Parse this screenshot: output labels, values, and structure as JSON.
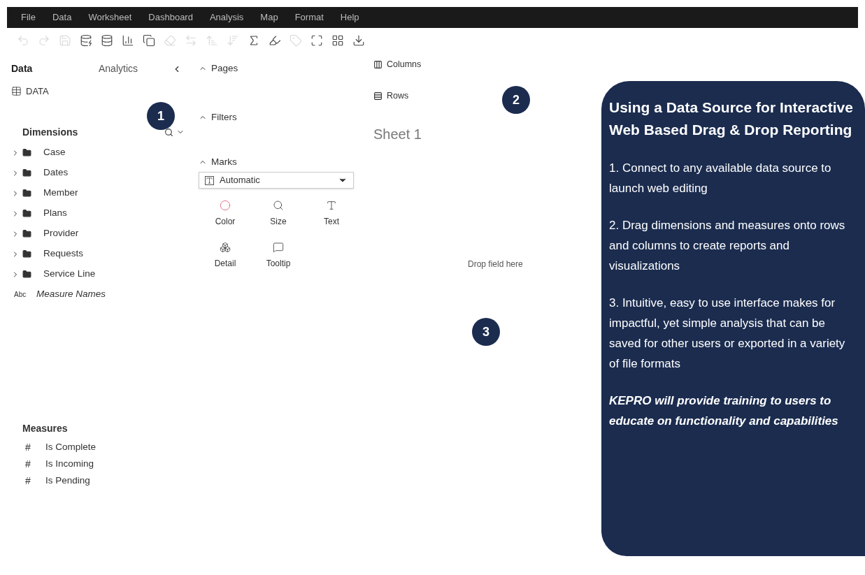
{
  "menu": [
    "File",
    "Data",
    "Worksheet",
    "Dashboard",
    "Analysis",
    "Map",
    "Format",
    "Help"
  ],
  "toolbar": [
    {
      "kind": "undo",
      "disabled": true
    },
    {
      "kind": "redo",
      "disabled": true
    },
    {
      "kind": "save",
      "disabled": true
    },
    {
      "kind": "new-source",
      "disabled": false
    },
    {
      "kind": "pause",
      "disabled": false
    },
    {
      "kind": "new-sheet",
      "disabled": false
    },
    {
      "kind": "duplicate",
      "disabled": false
    },
    {
      "kind": "clear",
      "disabled": true
    },
    {
      "kind": "swap",
      "disabled": true
    },
    {
      "kind": "sort-asc",
      "disabled": true
    },
    {
      "kind": "sort-desc",
      "disabled": true
    },
    {
      "kind": "sum",
      "disabled": false
    },
    {
      "kind": "highlight",
      "disabled": false
    },
    {
      "kind": "label",
      "disabled": true
    },
    {
      "kind": "fit",
      "disabled": false
    },
    {
      "kind": "show-me",
      "disabled": false
    },
    {
      "kind": "download",
      "disabled": false
    }
  ],
  "side_tabs": [
    {
      "label": "Data",
      "selected": true
    },
    {
      "label": "Analytics",
      "selected": false
    }
  ],
  "data_source": "DATA",
  "dimensions": {
    "title": "Dimensions",
    "items": [
      {
        "label": "Case",
        "kind": "folder"
      },
      {
        "label": "Dates",
        "kind": "folder"
      },
      {
        "label": "Member",
        "kind": "folder"
      },
      {
        "label": "Plans",
        "kind": "folder"
      },
      {
        "label": "Provider",
        "kind": "folder"
      },
      {
        "label": "Requests",
        "kind": "folder"
      },
      {
        "label": "Service Line",
        "kind": "folder"
      },
      {
        "label": "Measure Names",
        "kind": "text",
        "type_label": "Abc"
      }
    ]
  },
  "measures": {
    "title": "Measures",
    "items": [
      {
        "label": "Is Complete",
        "type_label": "#"
      },
      {
        "label": "Is Incoming",
        "type_label": "#"
      },
      {
        "label": "Is Pending",
        "type_label": "#"
      }
    ]
  },
  "cards": [
    "Pages",
    "Filters"
  ],
  "marks": {
    "title": "Marks",
    "type": "Automatic",
    "buttons": [
      {
        "label": "Color",
        "kind": "color"
      },
      {
        "label": "Size",
        "kind": "size"
      },
      {
        "label": "Text",
        "kind": "text"
      },
      {
        "label": "Detail",
        "kind": "detail"
      },
      {
        "label": "Tooltip",
        "kind": "tooltip"
      }
    ]
  },
  "shelves": [
    {
      "label": "Columns",
      "kind": "columns"
    },
    {
      "label": "Rows",
      "kind": "rows"
    }
  ],
  "sheet_title": "Sheet 1",
  "drop_hint": "Drop field here",
  "steps": [
    "1",
    "2",
    "3"
  ],
  "callout": {
    "title": "Using a Data Source for Interactive Web Based Drag & Drop Reporting",
    "points": [
      "1. Connect to any available data source to launch web editing",
      "2. Drag dimensions and measures onto rows and columns to create reports and visualizations",
      "3. Intuitive, easy to use interface makes for impactful, yet simple analysis that can be saved for other users or exported in a variety of file formats"
    ],
    "note": "KEPRO will provide training to users to educate on functionality and capabilities"
  }
}
